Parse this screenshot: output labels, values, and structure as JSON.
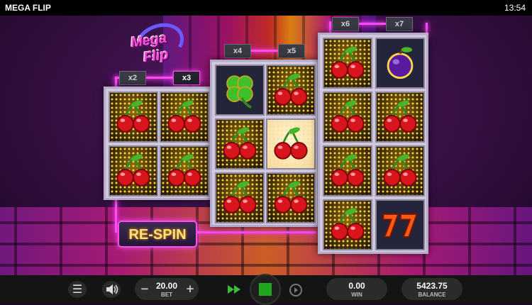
{
  "game": {
    "title": "MEGA FLIP",
    "clock": "13:54"
  },
  "logo": {
    "line1": "Mega",
    "line2": "Flip"
  },
  "multipliers": {
    "reel1": [
      "x2",
      "x3"
    ],
    "reel2": [
      "x4",
      "x5"
    ],
    "reel3": [
      "x6",
      "x7"
    ]
  },
  "reels": {
    "reel1": [
      [
        "cherry",
        "cherry"
      ],
      [
        "cherry",
        "cherry"
      ]
    ],
    "reel2": [
      [
        "clover",
        "cherry"
      ],
      [
        "cherry",
        "cherry"
      ],
      [
        "cherry",
        "cherry"
      ]
    ],
    "reel3": [
      [
        "cherry",
        "plum"
      ],
      [
        "cherry",
        "cherry"
      ],
      [
        "cherry",
        "cherry"
      ],
      [
        "cherry",
        "seven"
      ]
    ]
  },
  "respin": {
    "label": "RE-SPIN"
  },
  "controls": {
    "bet_value": "20.00",
    "bet_label": "BET",
    "win_value": "0.00",
    "win_label": "WIN",
    "balance_value": "5423.75",
    "balance_label": "BALANCE",
    "icons": [
      "menu-icon",
      "sound-icon",
      "minus-icon",
      "plus-icon",
      "fast-forward-icon",
      "spin-icon",
      "autoplay-icon"
    ]
  },
  "colors": {
    "neon": "#ff4cf2",
    "spin": "#1fa81f",
    "ffwd": "#3dbb3d",
    "respin_text": "#ffe37a"
  }
}
